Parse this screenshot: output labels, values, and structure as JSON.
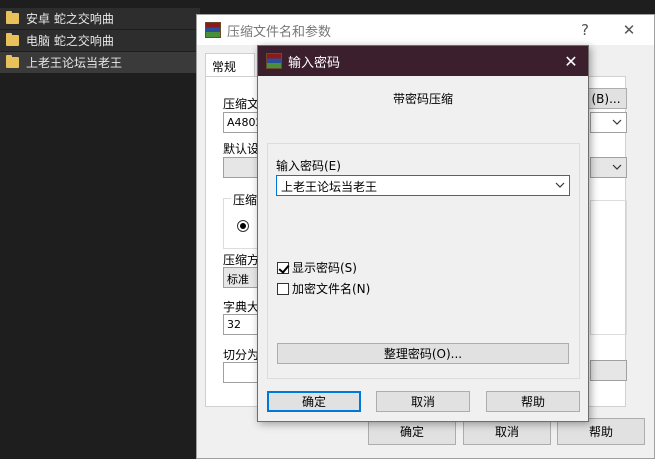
{
  "files": [
    {
      "name": "安卓 蛇之交响曲"
    },
    {
      "name": "电脑 蛇之交响曲"
    },
    {
      "name": "上老王论坛当老王"
    }
  ],
  "main_dialog": {
    "title": "压缩文件名和参数",
    "help_glyph": "?",
    "close_glyph": "✕",
    "tab_general": "常规",
    "label_archive_name": "压缩文",
    "archive_name_value": "A4802",
    "browse_button": "(B)...",
    "label_profile": "默认设",
    "format_group": "压缩",
    "label_method": "压缩方",
    "method_value": "标准",
    "label_dict": "字典大",
    "dict_value": "32",
    "label_split": "切分为",
    "ok": "确定",
    "cancel": "取消",
    "help": "帮助"
  },
  "password_dialog": {
    "title": "输入密码",
    "close_glyph": "✕",
    "heading": "带密码压缩",
    "label_password": "输入密码(E)",
    "password_value": "上老王论坛当老王",
    "show_password": {
      "label": "显示密码(S)",
      "checked": true
    },
    "encrypt_names": {
      "label": "加密文件名(N)",
      "checked": false
    },
    "organize_button": "整理密码(O)...",
    "ok": "确定",
    "cancel": "取消",
    "help": "帮助"
  }
}
